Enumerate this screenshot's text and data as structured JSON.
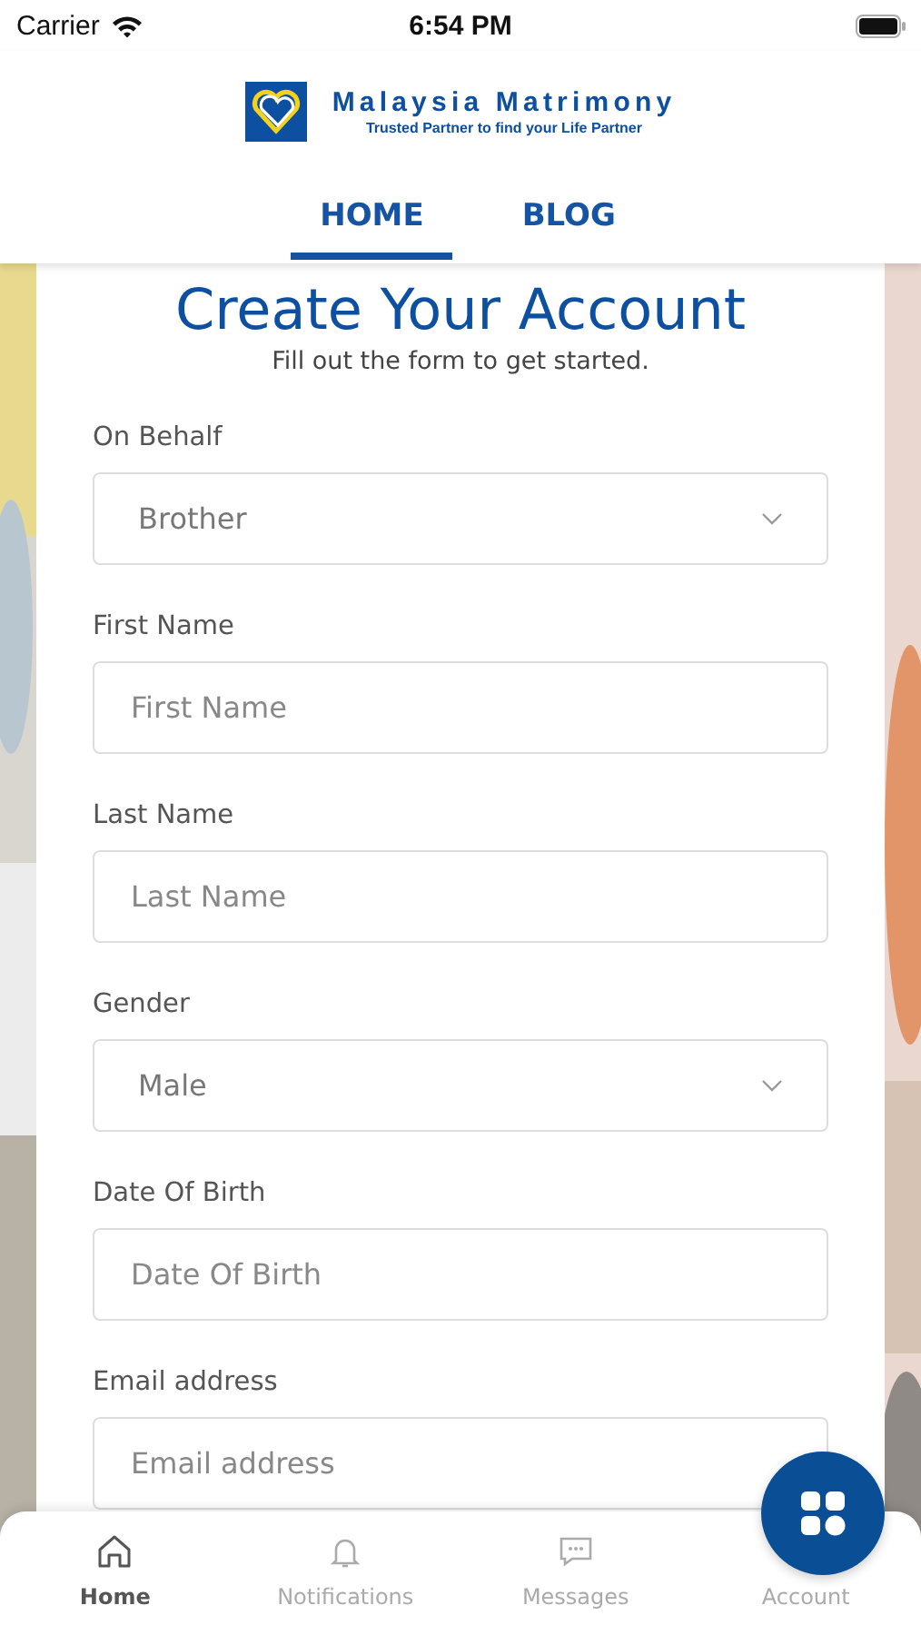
{
  "status_bar": {
    "carrier": "Carrier",
    "time": "6:54 PM"
  },
  "logo": {
    "name": "Malaysia Matrimony",
    "tagline": "Trusted Partner to find your Life Partner"
  },
  "tabs": [
    {
      "label": "HOME",
      "selected": true
    },
    {
      "label": "BLOG",
      "selected": false
    }
  ],
  "form": {
    "title": "Create Your Account",
    "subtitle": "Fill out the form to get started.",
    "fields": [
      {
        "kind": "select",
        "label": "On Behalf",
        "value": "Brother"
      },
      {
        "kind": "text",
        "label": "First Name",
        "placeholder": "First Name"
      },
      {
        "kind": "text",
        "label": "Last Name",
        "placeholder": "Last Name"
      },
      {
        "kind": "select",
        "label": "Gender",
        "value": "Male"
      },
      {
        "kind": "text",
        "label": "Date Of Birth",
        "placeholder": "Date Of Birth"
      },
      {
        "kind": "text",
        "label": "Email address",
        "placeholder": "Email address"
      }
    ]
  },
  "bottom_nav": [
    {
      "kind": "home",
      "label": "Home",
      "selected": true
    },
    {
      "kind": "bell",
      "label": "Notifications",
      "selected": false
    },
    {
      "kind": "chat",
      "label": "Messages",
      "selected": false
    },
    {
      "kind": "account",
      "label": "Account",
      "selected": false
    }
  ]
}
